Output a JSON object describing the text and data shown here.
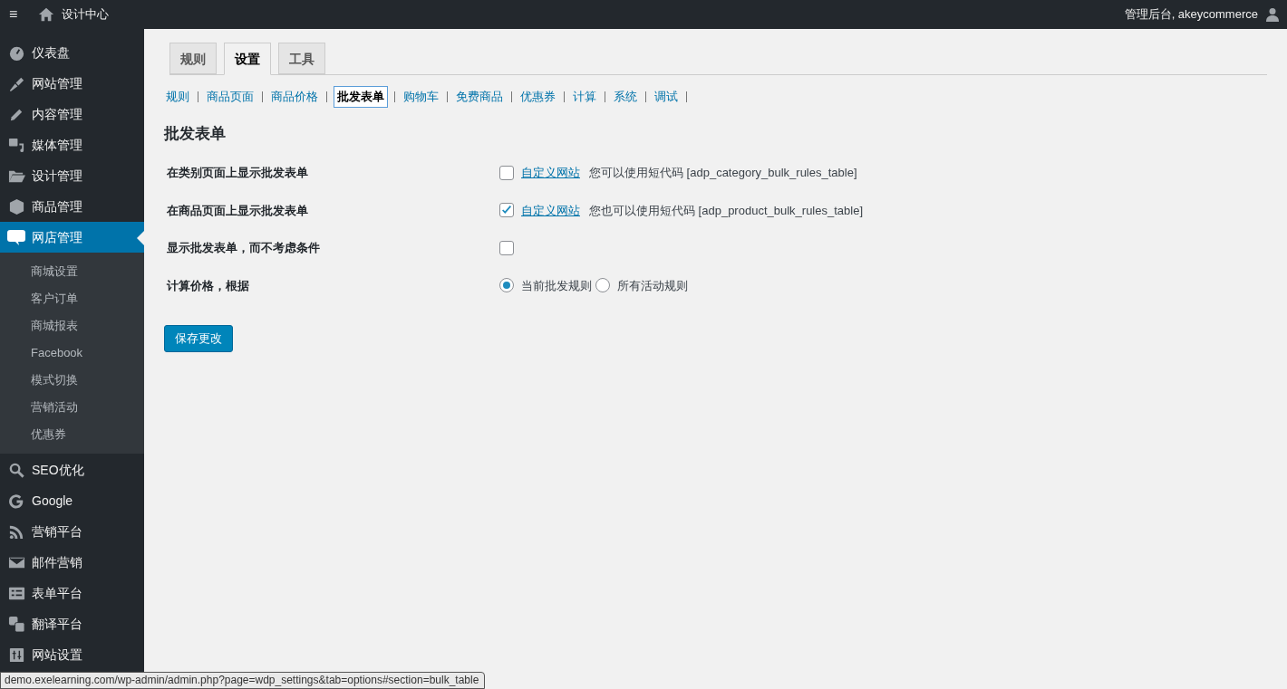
{
  "top_bar": {
    "menu_glyph": "≡",
    "site_title": "设计中心",
    "account": "管理后台, akeycommerce"
  },
  "sidebar": {
    "items": [
      {
        "label": "仪表盘",
        "selected": false
      },
      {
        "label": "网站管理",
        "selected": false
      },
      {
        "label": "内容管理",
        "selected": false
      },
      {
        "label": "媒体管理",
        "selected": false
      },
      {
        "label": "设计管理",
        "selected": false
      },
      {
        "label": "商品管理",
        "selected": false
      },
      {
        "label": "网店管理",
        "selected": true,
        "children": [
          {
            "label": "商城设置"
          },
          {
            "label": "客户订单"
          },
          {
            "label": "商城报表"
          },
          {
            "label": "Facebook"
          },
          {
            "label": "模式切换"
          },
          {
            "label": "营销活动"
          },
          {
            "label": "优惠券"
          }
        ]
      },
      {
        "label": "SEO优化",
        "selected": false
      },
      {
        "label": "Google",
        "selected": false
      },
      {
        "label": "营销平台",
        "selected": false
      },
      {
        "label": "邮件营销",
        "selected": false
      },
      {
        "label": "表单平台",
        "selected": false
      },
      {
        "label": "翻译平台",
        "selected": false
      },
      {
        "label": "网站设置",
        "selected": false
      }
    ]
  },
  "tabs": [
    {
      "label": "规则",
      "selected": false
    },
    {
      "label": "设置",
      "selected": true
    },
    {
      "label": "工具",
      "selected": false
    }
  ],
  "sections": [
    {
      "label": "规则",
      "selected": false
    },
    {
      "label": "商品页面",
      "selected": false
    },
    {
      "label": "商品价格",
      "selected": false
    },
    {
      "label": "批发表单",
      "selected": true
    },
    {
      "label": "购物车",
      "selected": false
    },
    {
      "label": "免费商品",
      "selected": false
    },
    {
      "label": "优惠券",
      "selected": false
    },
    {
      "label": "计算",
      "selected": false
    },
    {
      "label": "系统",
      "selected": false
    },
    {
      "label": "调试",
      "selected": false
    }
  ],
  "heading": "批发表单",
  "settings": [
    {
      "kind": "checkbox",
      "label": "在类别页面上显示批发表单",
      "checked": false,
      "link": "自定义网站",
      "note": "您可以使用短代码 [adp_category_bulk_rules_table]"
    },
    {
      "kind": "checkbox",
      "label": "在商品页面上显示批发表单",
      "checked": true,
      "link": "自定义网站",
      "note": "您也可以使用短代码 [adp_product_bulk_rules_table]"
    },
    {
      "kind": "checkbox",
      "label": "显示批发表单，而不考虑条件",
      "checked": false
    },
    {
      "kind": "radio",
      "label": "计算价格，根据",
      "options": [
        {
          "label": "当前批发规则",
          "selected": true
        },
        {
          "label": "所有活动规则",
          "selected": false
        }
      ]
    }
  ],
  "save_button": "保存更改",
  "status_url": "demo.exelearning.com/wp-admin/admin.php?page=wdp_settings&tab=options#section=bulk_table"
}
